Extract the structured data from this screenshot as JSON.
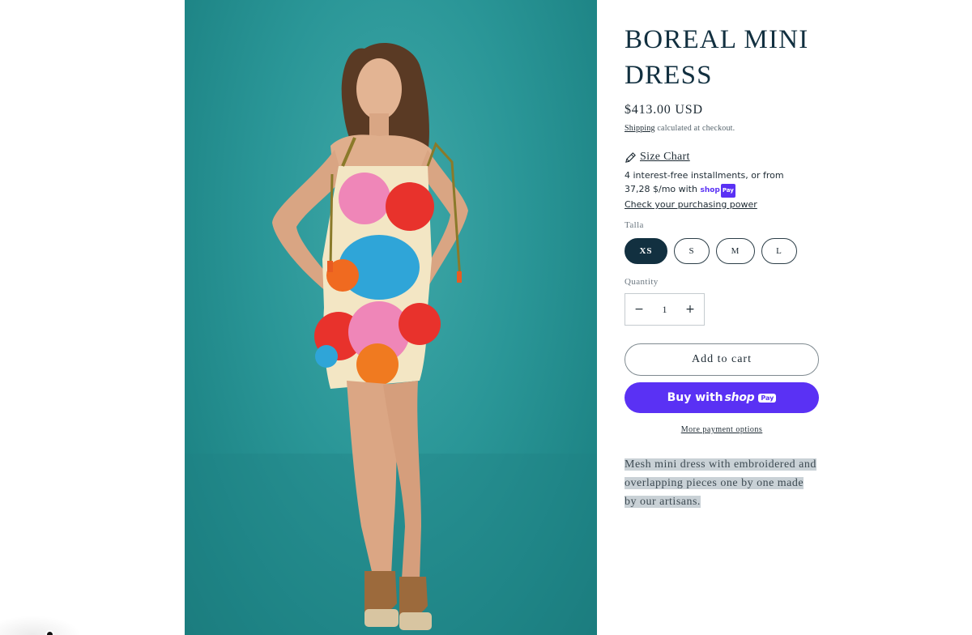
{
  "product": {
    "title": "BOREAL MINI DRESS",
    "price": "$413.00 USD",
    "shipping_link": "Shipping",
    "shipping_rest": " calculated at checkout.",
    "size_chart_label": "Size Chart",
    "installments_line1": "4 interest-free installments, or from",
    "installments_amount": "37,28 $/mo with ",
    "shop_brand": "shop",
    "shop_pay": "Pay",
    "purchasing_power": "Check your purchasing power",
    "size_label": "Talla",
    "sizes": [
      "XS",
      "S",
      "M",
      "L"
    ],
    "selected_size": "XS",
    "quantity_label": "Quantity",
    "quantity_value": "1",
    "qty_minus": "−",
    "qty_plus": "+",
    "add_to_cart": "Add to cart",
    "buy_with": "Buy with",
    "buy_brand": "shop",
    "buy_pay": "Pay",
    "more_payment": "More payment options",
    "description": "Mesh mini dress with embroidered and overlapping pieces one by one made by our artisans."
  },
  "icons": {
    "size_chart_icon": "pencil-ruler-icon"
  },
  "colors": {
    "brand_purple": "#5a31f4",
    "title_navy": "#123040",
    "photo_backdrop": "#2a9697"
  }
}
